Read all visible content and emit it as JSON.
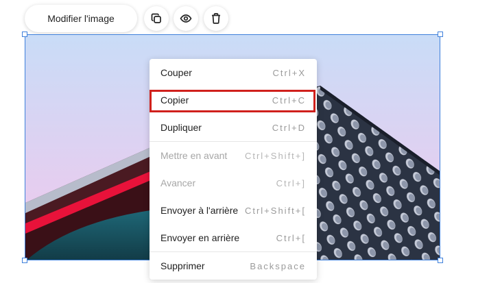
{
  "toolbar": {
    "edit_label": "Modifier l'image",
    "icons": [
      "copy-icon",
      "eye-icon",
      "trash-icon"
    ]
  },
  "image": {
    "colors": {
      "sky_top": "#c9dcf7",
      "sky_bottom": "#f2c7ec",
      "building_dark": "#2b3343",
      "red_accent": "#e8123a",
      "teal": "#1f6a7a",
      "selection": "#3d7fdb"
    }
  },
  "menu": {
    "items": [
      {
        "label": "Couper",
        "shortcut": "Ctrl+X",
        "disabled": false
      },
      {
        "label": "Copier",
        "shortcut": "Ctrl+C",
        "disabled": false,
        "highlighted": true
      },
      {
        "label": "Dupliquer",
        "shortcut": "Ctrl+D",
        "disabled": false
      },
      {
        "label": "Mettre en avant",
        "shortcut": "Ctrl+Shift+]",
        "disabled": true
      },
      {
        "label": "Avancer",
        "shortcut": "Ctrl+]",
        "disabled": true
      },
      {
        "label": "Envoyer à l'arrière",
        "shortcut": "Ctrl+Shift+[",
        "disabled": false
      },
      {
        "label": "Envoyer en arrière",
        "shortcut": "Ctrl+[",
        "disabled": false
      },
      {
        "label": "Supprimer",
        "shortcut": "Backspace",
        "disabled": false
      }
    ],
    "highlight_color": "#d0201c"
  }
}
